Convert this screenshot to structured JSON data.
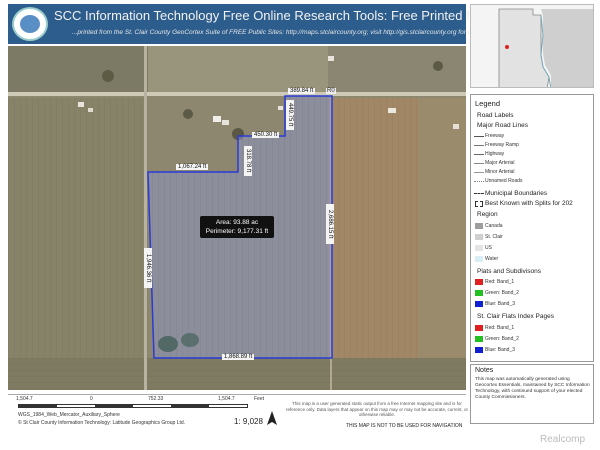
{
  "header": {
    "title": "SCC Information Technology Free Online Research Tools: Free Printed Map",
    "subtitle": "...printed from the St. Clair County GeoCortex Suite of FREE Public Sites: http://maps.stclaircounty.org; visit http://gis.stclaircounty.org for details."
  },
  "map": {
    "road_label": "R0",
    "parcel_popup": {
      "area": "Area: 93.88 ac",
      "perimeter": "Perimeter: 9,177.31 ft"
    },
    "dimensions": {
      "top_right": "389.84 ft",
      "notch_vertical": "449.75 ft",
      "notch_horizontal": "450.30 ft",
      "left_vertical_top": "318.78 ft",
      "top_left": "1,067.24 ft",
      "right": "2,686.15 ft",
      "left": "1,946.36 ft",
      "bottom": "1,868.89 ft"
    }
  },
  "legend": {
    "title": "Legend",
    "road_labels": "Road Labels",
    "major_road_lines": "Major Road Lines",
    "road_items": [
      {
        "label": "Freeway",
        "color": "#555555"
      },
      {
        "label": "Freeway Ramp",
        "color": "#777777"
      },
      {
        "label": "Highway",
        "color": "#666666"
      },
      {
        "label": "Major Arterial",
        "color": "#888888"
      },
      {
        "label": "Minor Arterial",
        "color": "#999999"
      },
      {
        "label": "Unnamed Roads",
        "color": "#bbbbbb"
      }
    ],
    "municipal_boundaries": "Municipal Boundaries",
    "best_known": "Best Known with Splits for 202",
    "region": "Region",
    "region_items": [
      {
        "label": "Canada",
        "color": "#9e9e9e"
      },
      {
        "label": "St. Clair",
        "color": "#cfcfcf"
      },
      {
        "label": "US",
        "color": "#e4e4e4"
      },
      {
        "label": "Water",
        "color": "#d8eef5"
      }
    ],
    "plats": "Plats and Subdivisons",
    "plat_items": [
      {
        "label": "Red:  Band_1",
        "color": "#e02020"
      },
      {
        "label": "Green: Band_2",
        "color": "#20c020"
      },
      {
        "label": "Blue:  Band_3",
        "color": "#1020d0"
      }
    ],
    "flats": "St. Clair Flats Index Pages",
    "flat_items": [
      {
        "label": "Red:  Band_1",
        "color": "#e02020"
      },
      {
        "label": "Green: Band_2",
        "color": "#20c020"
      },
      {
        "label": "Blue:  Band_3",
        "color": "#1020d0"
      }
    ]
  },
  "notes": {
    "title": "Notes",
    "text": "This map was automatically generated using Geocortex Essentials, maintained by SCC Information Technology, with continued support of your elected County Commissioners."
  },
  "scale": {
    "left": "1,504.7",
    "zero": "0",
    "mid": "752.33",
    "right": "1,504.7",
    "unit": "Feet",
    "projection": "WGS_1984_Web_Mercator_Auxiliary_Sphere",
    "copyright": "© St Clair County Information Technology: Latitude Geographics Group Ltd.",
    "ratio": "1: 9,028"
  },
  "disclaimer": "This map is a user generated static output from a free Internet mapping site and is for reference only. Data layers that appear on this map may or may not be accurate, current, or otherwise reliable.",
  "nav_warning": "THIS MAP IS NOT TO BE USED FOR NAVIGATION",
  "watermark": "Realcomp"
}
